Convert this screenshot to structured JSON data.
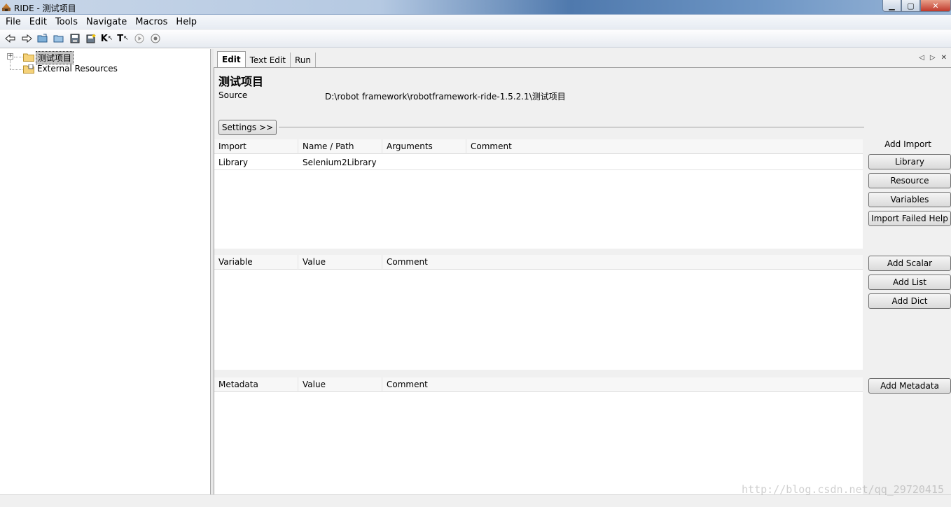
{
  "window": {
    "title": "RIDE - 测试项目",
    "buttons": {
      "minimize": "▁",
      "maximize": "▢",
      "close": "✕"
    }
  },
  "menu": [
    "File",
    "Edit",
    "Tools",
    "Navigate",
    "Macros",
    "Help"
  ],
  "toolbar": {
    "icons": [
      "back-arrow-icon",
      "forward-arrow-icon",
      "open-suite-icon",
      "open-directory-icon",
      "save-icon",
      "save-all-icon",
      "search-keywords-icon",
      "search-tests-icon",
      "run-icon",
      "stop-icon"
    ],
    "k_label": "K",
    "t_label": "T"
  },
  "tree": {
    "root_label": "测试项目",
    "external_label": "External Resources",
    "expander": "+"
  },
  "tabs": [
    "Edit",
    "Text Edit",
    "Run"
  ],
  "tab_controls": {
    "left": "◁",
    "right": "▷",
    "close": "✕"
  },
  "suite": {
    "title": "测试项目",
    "source_label": "Source",
    "source_value": "D:\\robot framework\\robotframework-ride-1.5.2.1\\测试项目"
  },
  "settings_button": "Settings >>",
  "imports": {
    "headers": [
      "Import",
      "Name / Path",
      "Arguments",
      "Comment"
    ],
    "rows": [
      [
        "Library",
        "Selenium2Library",
        "",
        ""
      ]
    ]
  },
  "variables": {
    "headers": [
      "Variable",
      "Value",
      "Comment"
    ]
  },
  "metadata": {
    "headers": [
      "Metadata",
      "Value",
      "Comment"
    ]
  },
  "side": {
    "add_import_label": "Add Import",
    "library": "Library",
    "resource": "Resource",
    "variables": "Variables",
    "import_failed_help": "Import Failed Help",
    "add_scalar": "Add Scalar",
    "add_list": "Add List",
    "add_dict": "Add Dict",
    "add_metadata": "Add Metadata"
  },
  "watermark": "http://blog.csdn.net/qq_29720415"
}
